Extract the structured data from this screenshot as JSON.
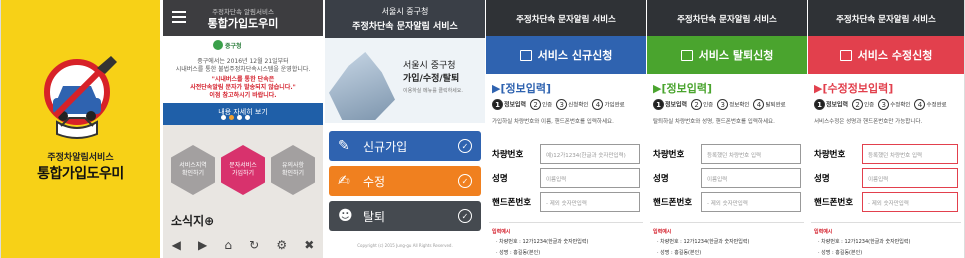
{
  "p1": {
    "subtitle": "주정차알림서비스",
    "title": "통합가입도우미"
  },
  "p2": {
    "header_sub": "주정차단속 알림서비스",
    "header_title": "통합가입도우미",
    "org": "중구청",
    "line1": "중구에서는 2016년 12월 21일부터",
    "line2": "시내버스를 통한 불법주정차단속시스템을 운영합니다.",
    "red1": "\"시내버스를 통한 단속은",
    "red2": "사전단속알림 문자가 발송되지 않습니다.\"",
    "red3": "이점 참고하시기 바랍니다.",
    "more": "내용 자세히 보기",
    "hex1": "서비스지역\n확인하기",
    "hex2": "문자서비스\n가입하기",
    "hex3": "유의사항\n확인하기",
    "news": "소식지⊕",
    "toolbar": [
      "◀",
      "▶",
      "⌂",
      "↻",
      "⚙",
      "✖"
    ]
  },
  "p3": {
    "header_a": "서울시 중구청",
    "header_b": "주정차단속 문자알림 서비스",
    "hero1": "서울시 중구청",
    "hero2": "가입/수정/탈퇴",
    "hero3": "이용하실 메뉴를 클릭하세요.",
    "btn_join": "신규가입",
    "btn_edit": "수정",
    "btn_leave": "탈퇴",
    "copyright": "Copyright (c) 2015 Jung-gu All Rights Reserved.",
    "colors": {
      "join": "#2f63b0",
      "edit": "#f0801f",
      "leave": "#454a50"
    }
  },
  "forms": [
    {
      "header": "주정차단속 문자알림 서비스",
      "banner": "서비스 신규신청",
      "color": "#2f63b0",
      "section": "▶[정보입력]",
      "steps": [
        "정보입력",
        "인증",
        "신청확인",
        "가입완료"
      ],
      "desc": "가입하실 차량번호와 이름, 핸드폰번호를 입력하세요.",
      "car_label": "차량번호",
      "car_ph": "예)12가1234(한글과 숫자만입력)",
      "name_label": "성명",
      "name_ph": "이름입력",
      "phone_label": "핸드폰번호",
      "phone_ph": "- 제외 숫자만입력",
      "hint": "입력예시",
      "hint1": "· 차량번호 : 12가1234(한글과 숫자만입력)",
      "hint2": "· 성명 : 홍길동(본인)"
    },
    {
      "header": "주정차단속 문자알림 서비스",
      "banner": "서비스 탈퇴신청",
      "color": "#4aa42e",
      "section": "▶[정보입력]",
      "steps": [
        "정보입력",
        "인증",
        "정보확인",
        "탈퇴완료"
      ],
      "desc": "탈퇴하실 차량번호와 성명, 핸드폰번호를 입력하세요.",
      "car_label": "차량번호",
      "car_ph": "등록했던 차량번호 입력",
      "name_label": "성명",
      "name_ph": "이름입력",
      "phone_label": "핸드폰번호",
      "phone_ph": "- 제외 숫자만입력",
      "hint": "입력예시",
      "hint1": "· 차량번호 : 12가1234(한글과 숫자만입력)",
      "hint2": "· 성명 : 홍길동(본인)"
    },
    {
      "header": "주정차단속 문자알림 서비스",
      "banner": "서비스 수정신청",
      "color": "#e2404d",
      "section": "▶[수정정보입력]",
      "steps": [
        "정보입력",
        "인증",
        "수정확인",
        "수정완료"
      ],
      "desc": "서비스수정은 성명과 핸드폰번호만 가능합니다.",
      "car_label": "차량번호",
      "car_ph": "등록했던 차량번호 입력",
      "name_label": "성명",
      "name_ph": "이름입력",
      "phone_label": "핸드폰번호",
      "phone_ph": "- 제외 숫자만입력",
      "hint": "입력예시",
      "hint1": "· 차량번호 : 12가1234(한글과 숫자만입력)",
      "hint2": "· 성명 : 홍길동(본인)"
    }
  ]
}
